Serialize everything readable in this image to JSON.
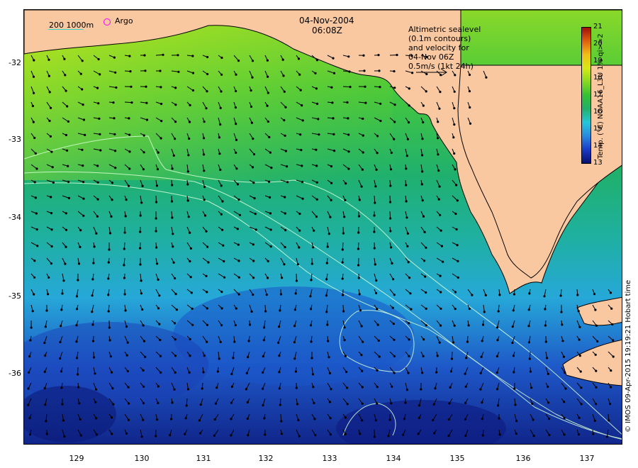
{
  "header": {
    "date": "04-Nov-2004",
    "time": "06:08Z"
  },
  "legend": {
    "contours": "200  1000m",
    "argo": "Argo",
    "altimetry_lines": [
      "Altimetric sealevel",
      "(0.1m contours)",
      "and velocity for",
      "04-Nov 06Z",
      "0.5m/s (1kt 24h)"
    ]
  },
  "axes": {
    "x_ticks": [
      "129",
      "130",
      "131",
      "132",
      "133",
      "134",
      "135",
      "136",
      "137"
    ],
    "y_ticks": [
      "-32",
      "-33",
      "-34",
      "-35",
      "-36"
    ]
  },
  "colorbar": {
    "title": "Temp. (°C) NOAA16_L3U 1% qi>=2",
    "ticks": [
      "21",
      "20",
      "19",
      "18",
      "17",
      "16",
      "15",
      "14",
      "13"
    ],
    "range": [
      13,
      21
    ],
    "colors": [
      "#08106e",
      "#1a3bc8",
      "#2a8ae0",
      "#26c6d8",
      "#22b06a",
      "#35c035",
      "#88d822",
      "#d6e818",
      "#f0c018",
      "#e06010",
      "#a01008"
    ]
  },
  "credit": "© IMOS 09-Apr-2015 19:19:21 Hobart time",
  "colors": {
    "land": "#f9c8a0",
    "frame": "#000000"
  }
}
